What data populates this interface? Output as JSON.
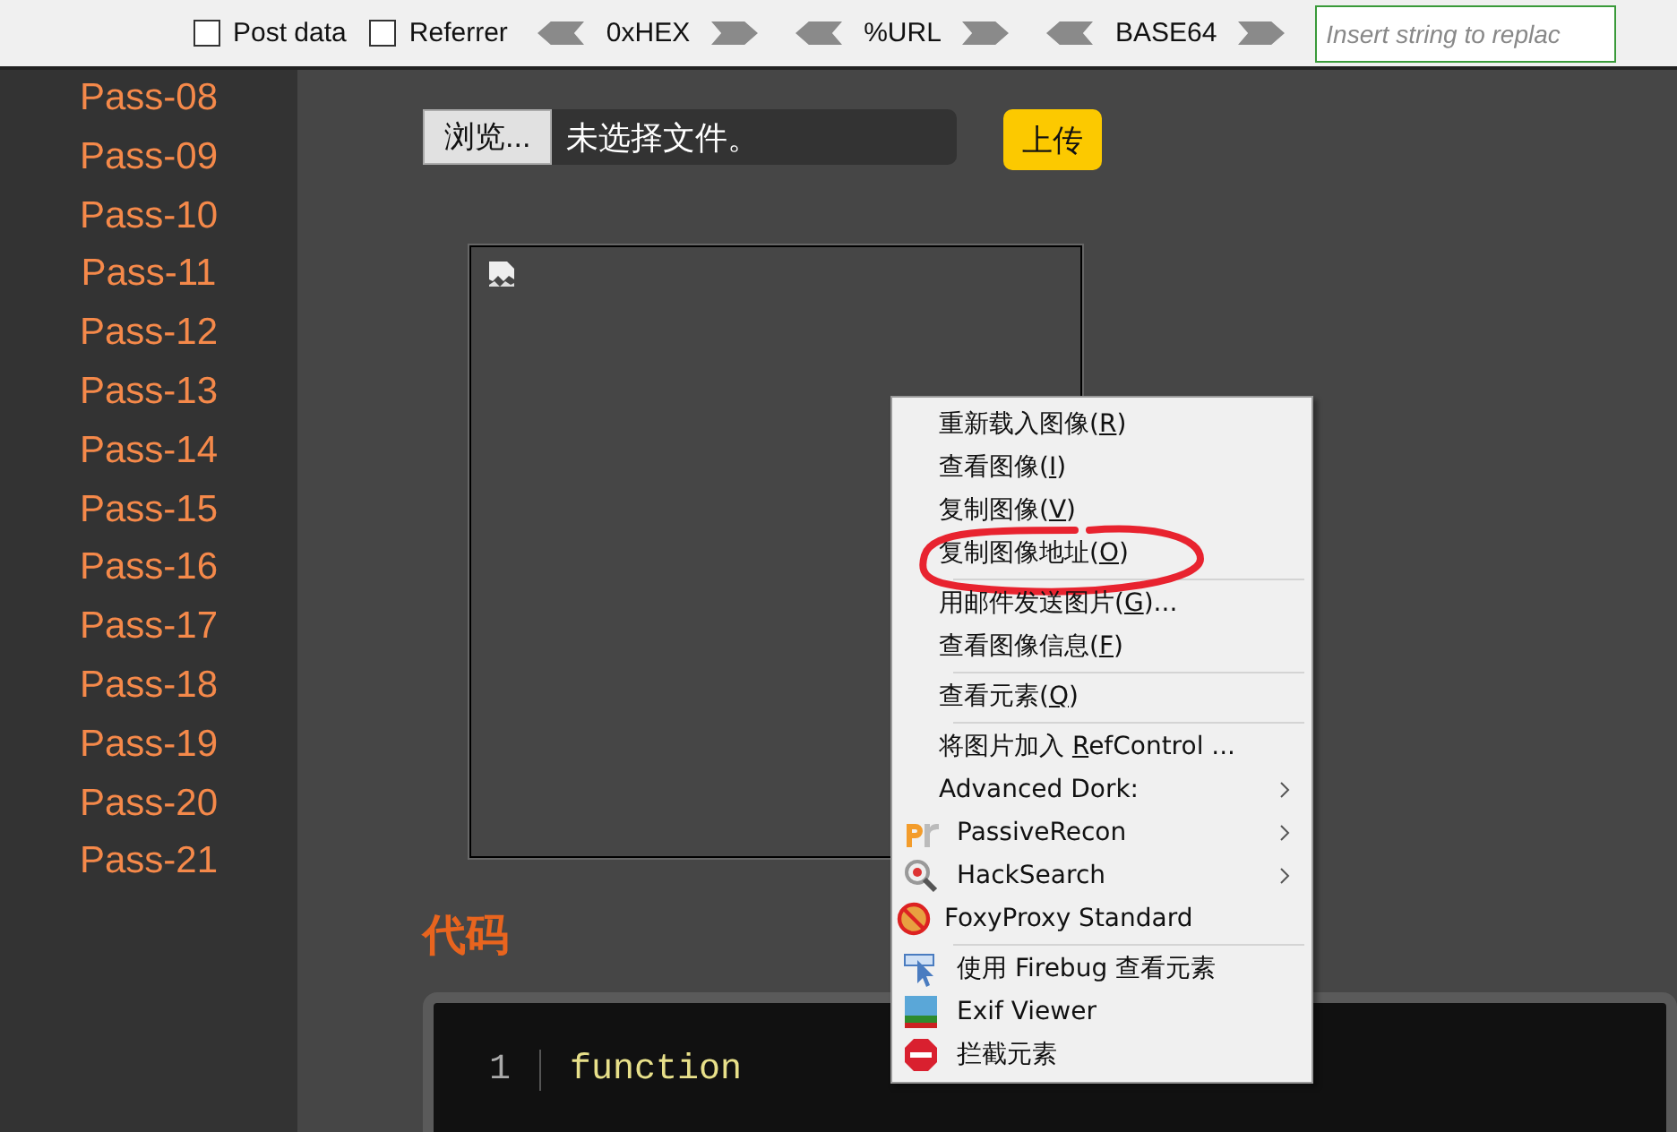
{
  "toolbar": {
    "checkboxes": [
      {
        "label": "Post data",
        "checked": false
      },
      {
        "label": "Referrer",
        "checked": false
      }
    ],
    "encoders": [
      "0xHEX",
      "%URL",
      "BASE64"
    ],
    "input": {
      "placeholder": "Insert string to replac"
    }
  },
  "sidebar": {
    "items": [
      "Pass-08",
      "Pass-09",
      "Pass-10",
      "Pass-11",
      "Pass-12",
      "Pass-13",
      "Pass-14",
      "Pass-15",
      "Pass-16",
      "Pass-17",
      "Pass-18",
      "Pass-19",
      "Pass-20",
      "Pass-21"
    ]
  },
  "upload": {
    "browse_button": "浏览...",
    "file_status": "未选择文件。",
    "submit_button": "上传"
  },
  "image": {
    "broken": true
  },
  "code_section": {
    "heading": "代码",
    "lines": [
      {
        "number": "1",
        "code": "function"
      }
    ]
  },
  "context_menu": {
    "items": [
      {
        "kind": "item",
        "label": "重新载入图像(",
        "key": "R",
        "after": ")",
        "submenu": false
      },
      {
        "kind": "item",
        "label": "查看图像(",
        "key": "I",
        "after": ")",
        "submenu": false
      },
      {
        "kind": "item",
        "label": "复制图像(",
        "key": "V",
        "after": ")",
        "submenu": false
      },
      {
        "kind": "item",
        "label": "复制图像地址(",
        "key": "O",
        "after": ")",
        "submenu": false,
        "circled": true
      },
      {
        "kind": "separator"
      },
      {
        "kind": "item",
        "label": "用邮件发送图片(",
        "key": "G",
        "after": ")...",
        "submenu": false
      },
      {
        "kind": "item",
        "label": "查看图像信息(",
        "key": "F",
        "after": ")",
        "submenu": false
      },
      {
        "kind": "separator"
      },
      {
        "kind": "item",
        "label": "查看元素(",
        "key": "Q",
        "after": ")",
        "submenu": false
      },
      {
        "kind": "separator"
      },
      {
        "kind": "item",
        "label": "将图片加入 ",
        "key": "R",
        "after": "efControl ...",
        "submenu": false
      },
      {
        "kind": "item",
        "label": "Advanced Dork:",
        "submenu": true
      },
      {
        "kind": "icon_item",
        "label": "PassiveRecon",
        "submenu": true
      },
      {
        "kind": "icon_item",
        "label": "HackSearch",
        "submenu": true
      },
      {
        "kind": "icon_item",
        "label": "FoxyProxy Standard",
        "submenu": false
      },
      {
        "kind": "separator"
      },
      {
        "kind": "icon_item",
        "label": "使用 Firebug 查看元素",
        "submenu": false
      },
      {
        "kind": "icon_item",
        "label": "Exif Viewer",
        "submenu": false
      },
      {
        "kind": "icon_item",
        "label": "拦截元素",
        "submenu": false
      }
    ]
  }
}
